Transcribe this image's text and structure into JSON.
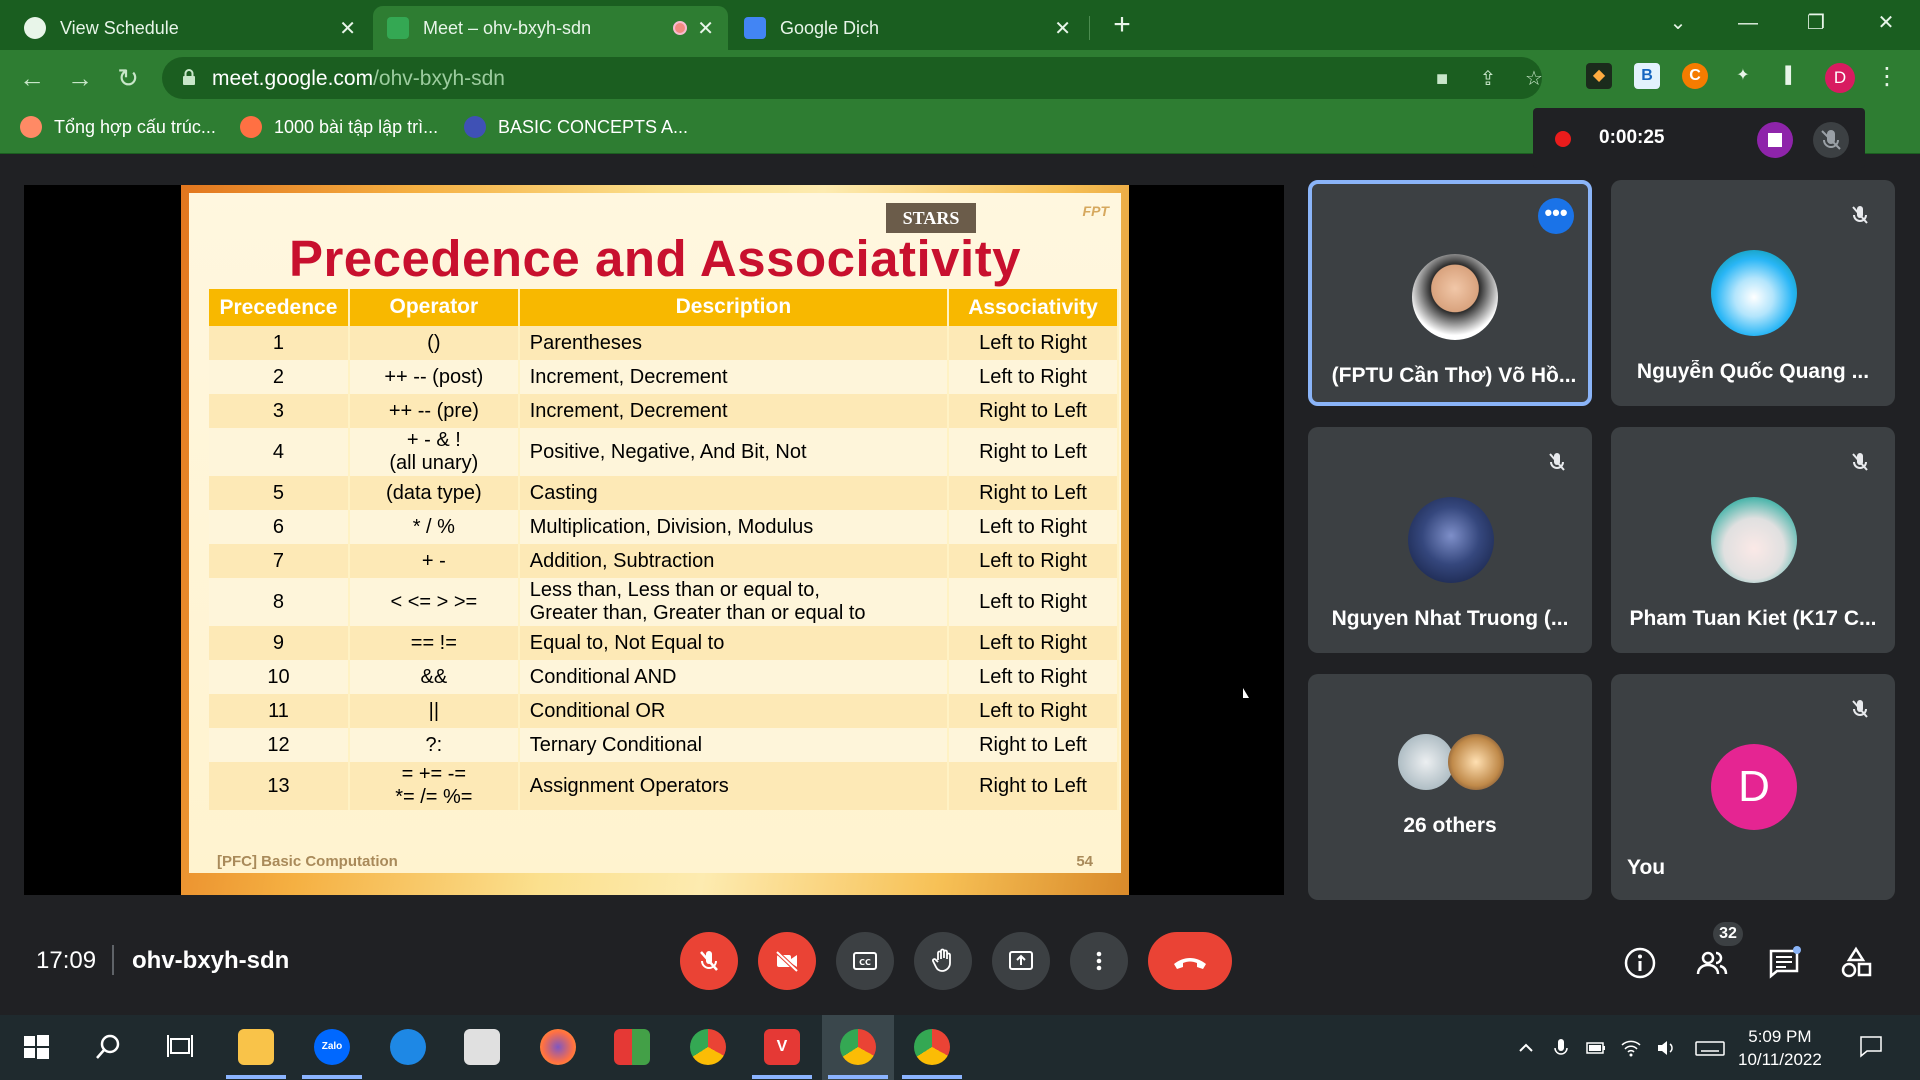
{
  "browser": {
    "tabs": [
      {
        "title": "View Schedule",
        "active": false
      },
      {
        "title": "Meet – ohv-bxyh-sdn",
        "active": true
      },
      {
        "title": "Google Dịch",
        "active": false
      }
    ],
    "url_host": "meet.google.com",
    "url_path": "/ohv-bxyh-sdn",
    "bookmarks": [
      "Tổng hợp cấu trúc...",
      "1000 bài tập lập trì...",
      "BASIC CONCEPTS A..."
    ],
    "profile_initial": "D",
    "accent": "#2e7d32"
  },
  "recording": {
    "time": "0:00:25"
  },
  "slide": {
    "logo": "STARS",
    "title": "Precedence and Associativity",
    "headers": [
      "Precedence",
      "Operator",
      "Description",
      "Associativity"
    ],
    "rows": [
      {
        "prec": "1",
        "op": "()",
        "desc": "Parentheses",
        "assoc": "Left to Right"
      },
      {
        "prec": "2",
        "op": "++  --  (post)",
        "desc": "Increment, Decrement",
        "assoc": "Left to Right"
      },
      {
        "prec": "3",
        "op": "++  --  (pre)",
        "desc": "Increment, Decrement",
        "assoc": "Right to Left"
      },
      {
        "prec": "4",
        "op": "+  -  &  !\n(all unary)",
        "desc": "Positive, Negative, And Bit, Not",
        "assoc": "Right to Left"
      },
      {
        "prec": "5",
        "op": "(data type)",
        "desc": "Casting",
        "assoc": "Right to Left"
      },
      {
        "prec": "6",
        "op": "*  /  %",
        "desc": "Multiplication, Division, Modulus",
        "assoc": "Left to Right"
      },
      {
        "prec": "7",
        "op": "+  -",
        "desc": "Addition, Subtraction",
        "assoc": "Left to Right"
      },
      {
        "prec": "8",
        "op": "<  <=  >  >=",
        "desc": "Less than, Less than or equal to,\nGreater than, Greater than or equal to",
        "assoc": "Left to Right"
      },
      {
        "prec": "9",
        "op": "==  !=",
        "desc": "Equal to, Not Equal to",
        "assoc": "Left to Right"
      },
      {
        "prec": "10",
        "op": "&&",
        "desc": "Conditional AND",
        "assoc": "Left to Right"
      },
      {
        "prec": "11",
        "op": "||",
        "desc": "Conditional OR",
        "assoc": "Left to Right"
      },
      {
        "prec": "12",
        "op": "?:",
        "desc": "Ternary Conditional",
        "assoc": "Right to Left"
      },
      {
        "prec": "13",
        "op": "=  +=  -=\n*=  /=  %=",
        "desc": "Assignment Operators",
        "assoc": "Right to Left"
      }
    ],
    "footer": "[PFC] Basic Computation",
    "page": "54"
  },
  "participants": [
    {
      "name": "(FPTU Cần Thơ) Võ Hồ...",
      "speaking": true
    },
    {
      "name": "Nguyễn Quốc Quang ...",
      "muted": true
    },
    {
      "name": "Nguyen Nhat Truong (...",
      "muted": true
    },
    {
      "name": "Pham Tuan Kiet (K17 C...",
      "muted": true
    },
    {
      "name": "26 others"
    },
    {
      "name": "You",
      "initial": "D",
      "muted": true
    }
  ],
  "meeting": {
    "time": "17:09",
    "code": "ohv-bxyh-sdn",
    "participant_count": "32"
  },
  "taskbar": {
    "time": "5:09 PM",
    "date": "10/11/2022",
    "zalo_label": "Zalo"
  }
}
